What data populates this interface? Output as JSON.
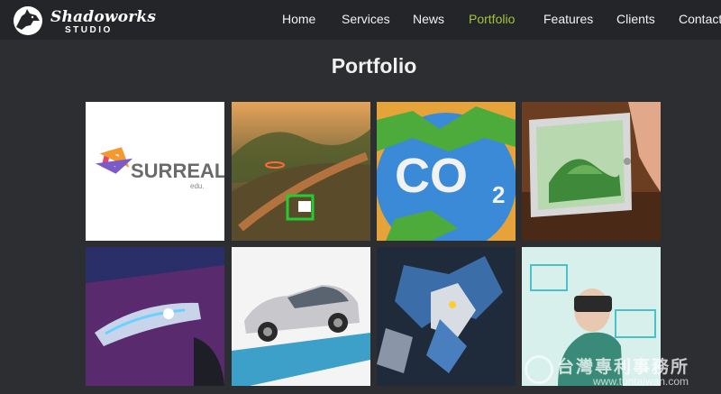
{
  "brand": {
    "name": "Shadoworks",
    "subtitle": "STUDIO"
  },
  "nav": {
    "items": [
      {
        "label": "Home",
        "active": false
      },
      {
        "label": "Services",
        "active": false
      },
      {
        "label": "News",
        "active": false
      },
      {
        "label": "Portfolio",
        "active": true
      },
      {
        "label": "Features",
        "active": false
      },
      {
        "label": "Clients",
        "active": false
      },
      {
        "label": "Contact",
        "active": false
      }
    ]
  },
  "portfolio": {
    "title": "Portfolio",
    "items": [
      {
        "label": "SURREAL",
        "sub": "edu."
      },
      {
        "label": ""
      },
      {
        "label": "CO",
        "sub": "2"
      },
      {
        "label": ""
      },
      {
        "label": ""
      },
      {
        "label": ""
      },
      {
        "label": ""
      },
      {
        "label": ""
      }
    ]
  },
  "watermark": {
    "text": "台灣專利事務所",
    "url": "www.tuntaiwan.com"
  },
  "colors": {
    "background": "#2d2e31",
    "header": "#242528",
    "accent": "#a4c23f",
    "text": "#f2f2f2"
  }
}
